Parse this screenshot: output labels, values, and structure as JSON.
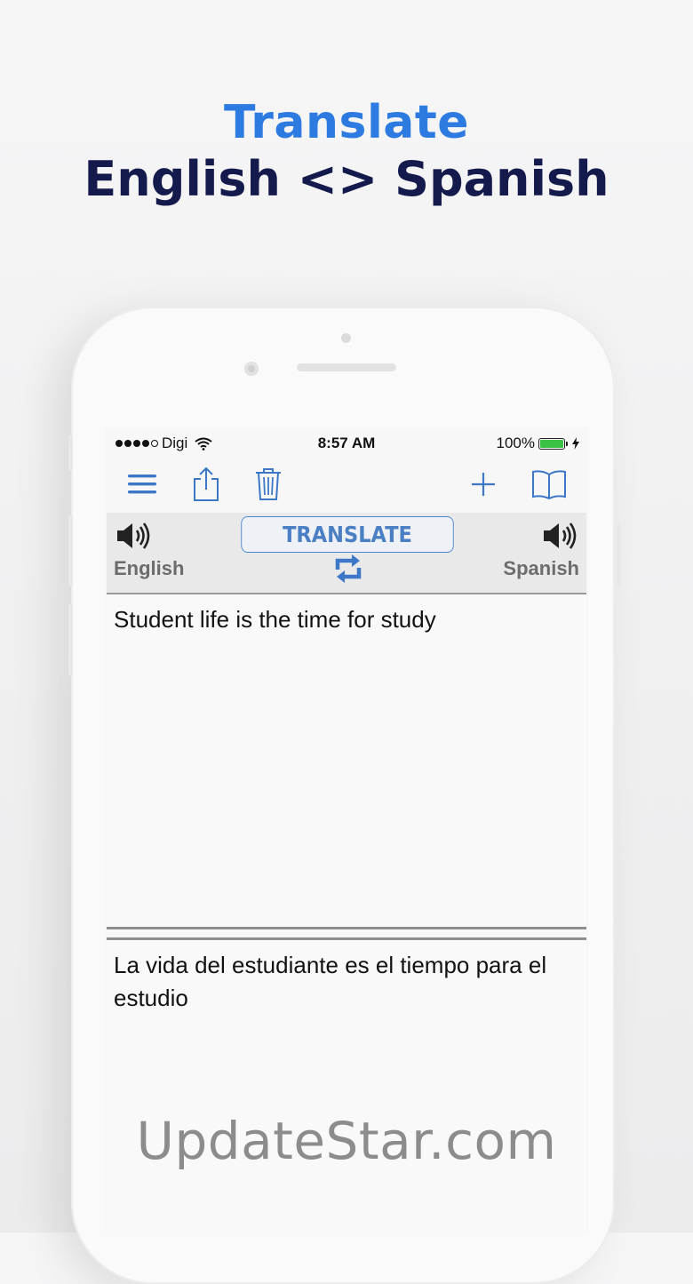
{
  "headline": {
    "line1": "Translate",
    "line2": "English <> Spanish"
  },
  "statusbar": {
    "carrier": "Digi",
    "time": "8:57 AM",
    "battery": "100%",
    "battery_level": 1.0
  },
  "toolbar": {
    "icons": [
      "menu-icon",
      "share-icon",
      "trash-icon",
      "plus-icon",
      "book-icon"
    ]
  },
  "langbar": {
    "translate_label": "TRANSLATE",
    "source_language": "English",
    "target_language": "Spanish"
  },
  "source_text": "Student life is the time for study",
  "translated_text": "La vida del estudiante es el tiempo para el estudio",
  "watermark": "UpdateStar.com",
  "colors": {
    "accent": "#2d7be0",
    "headline_dark": "#151a4d",
    "icon_blue": "#3d78c8",
    "battery_green": "#39c244"
  }
}
